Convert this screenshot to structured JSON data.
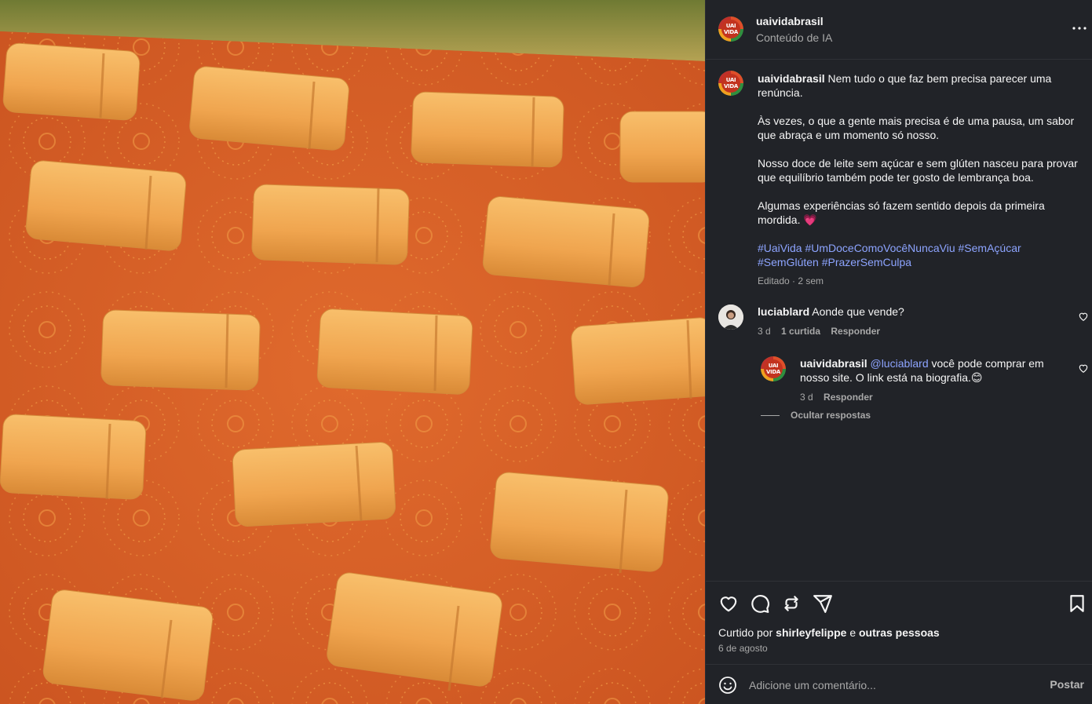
{
  "post": {
    "author": "uaivida­brasil",
    "subtitle": "Conteúdo de IA",
    "avatar_text_top": "UAI",
    "avatar_text_bottom": "VIDA"
  },
  "caption": {
    "author": "uaividabrasil",
    "p1": "Nem tudo o que faz bem precisa parecer uma renúncia.",
    "p2": "Às vezes, o que a gente mais precisa é de uma pausa, um sabor que abraça e um momento só nosso.",
    "p3": "Nosso doce de leite sem açúcar e sem glúten nasceu para provar que equilíbrio também pode ter gosto de lembrança boa.",
    "p4": "Algumas experiências só fazem sentido depois da primeira mordida.",
    "p4_emoji": "💗",
    "tags": "#UaiVida #UmDoceComoVocêNuncaViu #SemAçúcar #SemGlúten #PrazerSemCulpa",
    "edited": "Editado · 2 sem"
  },
  "comments": [
    {
      "author": "luciablard",
      "text": "Aonde que vende?",
      "time": "3 d",
      "likes": "1 curtida",
      "reply": "Responder"
    }
  ],
  "reply": {
    "author": "uaividabrasil",
    "mention": "@luciablard",
    "text": "você pode comprar em nosso site. O link está na biografia.",
    "emoji": "😊",
    "time": "3 d",
    "reply": "Responder"
  },
  "hide_replies": "Ocultar respostas",
  "likes_summary": {
    "prefix": "Curtido por",
    "user": "shirleyfelippe",
    "middle": "e",
    "others": "outras pessoas"
  },
  "date": "6 de agosto",
  "composer": {
    "placeholder": "Adicione um comentário...",
    "post_label": "Postar"
  },
  "colors": {
    "panel_bg": "#212328",
    "link": "#8da4ff",
    "muted": "#a8a8a8",
    "image_bg": "#d9642a",
    "candy": "#f2ac55"
  },
  "icons": [
    "more-icon",
    "heart-icon",
    "comment-icon",
    "share-icon",
    "send-icon",
    "bookmark-icon",
    "emoji-icon"
  ]
}
